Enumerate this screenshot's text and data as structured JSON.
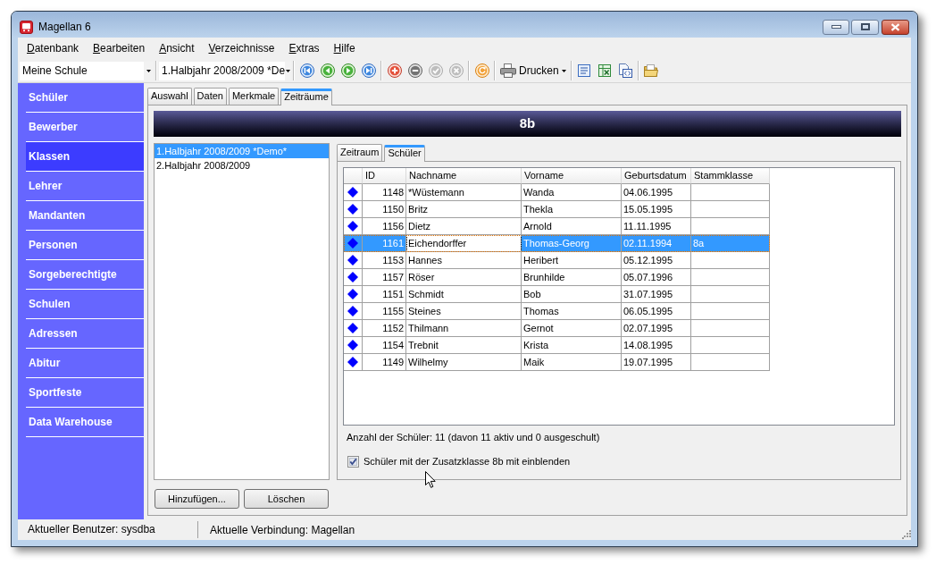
{
  "window": {
    "title": "Magellan 6"
  },
  "menu": [
    {
      "label": "Datenbank"
    },
    {
      "label": "Bearbeiten"
    },
    {
      "label": "Ansicht"
    },
    {
      "label": "Verzeichnisse"
    },
    {
      "label": "Extras"
    },
    {
      "label": "Hilfe"
    }
  ],
  "toolbar": {
    "combos": [
      {
        "value": "Meine Schule"
      },
      {
        "value": "1.Halbjahr 2008/2009 *De"
      }
    ],
    "groups": [
      [
        {
          "kind": "first",
          "disabled": false
        },
        {
          "kind": "previous",
          "disabled": false
        },
        {
          "kind": "next",
          "disabled": false
        },
        {
          "kind": "last",
          "disabled": false
        }
      ],
      [
        {
          "kind": "add",
          "disabled": false
        },
        {
          "kind": "remove",
          "disabled": false
        },
        {
          "kind": "confirm",
          "disabled": true
        },
        {
          "kind": "cancel",
          "disabled": true
        }
      ],
      [
        {
          "kind": "refresh",
          "disabled": false
        }
      ],
      [
        {
          "kind": "print",
          "label": "Drucken",
          "disabled": false
        }
      ],
      [
        {
          "kind": "document",
          "disabled": false
        },
        {
          "kind": "spreadsheet",
          "disabled": false
        },
        {
          "kind": "html",
          "disabled": false
        }
      ],
      [
        {
          "kind": "open",
          "disabled": false
        }
      ]
    ]
  },
  "sidebar": {
    "items": [
      {
        "label": "Schüler",
        "selected": false
      },
      {
        "label": "Bewerber",
        "selected": false
      },
      {
        "label": "Klassen",
        "selected": true
      },
      {
        "label": "Lehrer",
        "selected": false
      },
      {
        "label": "Mandanten",
        "selected": false
      },
      {
        "label": "Personen",
        "selected": false
      },
      {
        "label": "Sorgeberechtigte",
        "selected": false
      },
      {
        "label": "Schulen",
        "selected": false
      },
      {
        "label": "Adressen",
        "selected": false
      },
      {
        "label": "Abitur",
        "selected": false
      },
      {
        "label": "Sportfeste",
        "selected": false
      },
      {
        "label": "Data Warehouse",
        "selected": false
      }
    ]
  },
  "tabs": [
    {
      "label": "Auswahl",
      "selected": false
    },
    {
      "label": "Daten",
      "selected": false
    },
    {
      "label": "Merkmale",
      "selected": false
    },
    {
      "label": "Zeiträume",
      "selected": true
    }
  ],
  "class_header": {
    "title": "8b"
  },
  "periods": {
    "items": [
      {
        "label": "1.Halbjahr 2008/2009 *Demo*",
        "selected": true
      },
      {
        "label": "2.Halbjahr 2008/2009",
        "selected": false
      }
    ],
    "buttons": [
      {
        "label": "Hinzufügen..."
      },
      {
        "label": "Löschen"
      }
    ]
  },
  "student_tabs": [
    {
      "label": "Zeitraum",
      "selected": false
    },
    {
      "label": "Schüler",
      "selected": true
    }
  ],
  "table": {
    "columns": [
      {
        "label": "ID",
        "focused": false
      },
      {
        "label": "Nachname",
        "focused": true
      },
      {
        "label": "Vorname",
        "focused": false
      },
      {
        "label": "Geburtsdatum",
        "focused": false
      },
      {
        "label": "Stammklasse",
        "focused": false
      }
    ],
    "rows": [
      {
        "cells": [
          "1148",
          "*Wüstemann",
          "Wanda",
          "04.06.1995"
        ],
        "selected": false
      },
      {
        "cells": [
          "1150",
          "Britz",
          "Thekla",
          "15.05.1995"
        ],
        "selected": false
      },
      {
        "cells": [
          "1156",
          "Dietz",
          "Arnold",
          "11.11.1995"
        ],
        "selected": false
      },
      {
        "cells": [
          "1161",
          "Eichendorffer",
          "Thomas-Georg",
          "02.11.1994",
          "8a"
        ],
        "selected": true
      },
      {
        "cells": [
          "1153",
          "Hannes",
          "Heribert",
          "05.12.1995"
        ],
        "selected": false
      },
      {
        "cells": [
          "1157",
          "Röser",
          "Brunhilde",
          "05.07.1996"
        ],
        "selected": false
      },
      {
        "cells": [
          "1151",
          "Schmidt",
          "Bob",
          "31.07.1995"
        ],
        "selected": false
      },
      {
        "cells": [
          "1155",
          "Steines",
          "Thomas",
          "06.05.1995"
        ],
        "selected": false
      },
      {
        "cells": [
          "1152",
          "Thilmann",
          "Gernot",
          "02.07.1995"
        ],
        "selected": false
      },
      {
        "cells": [
          "1154",
          "Trebnit",
          "Krista",
          "14.08.1995"
        ],
        "selected": false
      },
      {
        "cells": [
          "1149",
          "Wilhelmy",
          "Maik",
          "19.07.1995"
        ],
        "selected": false
      }
    ]
  },
  "summary": "Anzahl der Schüler: 11 (davon 11 aktiv und 0 ausgeschult)",
  "show_extra_class": {
    "label": "Schüler mit der Zusatzklasse 8b mit einblenden",
    "checked": true
  },
  "status_bar": [
    {
      "text": "Aktueller Benutzer: sysdba"
    },
    {
      "text": "Aktuelle Verbindung: Magellan"
    }
  ]
}
